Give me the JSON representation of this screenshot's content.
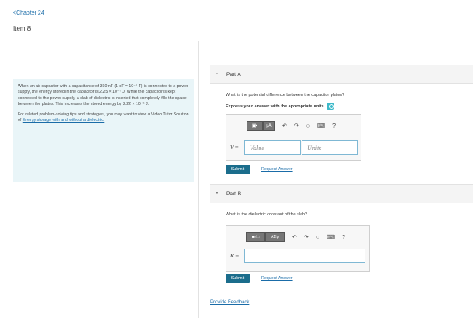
{
  "header": {
    "back_label": "<Chapter 24",
    "item_title": "Item 8"
  },
  "problem": {
    "paragraph1": "When an air capacitor with a capacitance of 360 nF (1 nF = 10⁻⁹ F) is connected to a power supply, the energy stored in the capacitor is 2.25 × 10⁻⁵ J. While the capacitor is kept connected to the power supply, a slab of dielectric is inserted that completely fills the space between the plates. This increases the stored energy by 2.22 × 10⁻⁵ J.",
    "paragraph2_prefix": "For related problem-solving tips and strategies, you may want to view a Video Tutor Solution of ",
    "paragraph2_link": "Energy storage with and without a dielectric."
  },
  "part_a": {
    "label": "Part A",
    "question": "What is the potential difference between the capacitor plates?",
    "instruction": "Express your answer with the appropriate units.",
    "variable": "V =",
    "value_placeholder": "Value",
    "units_placeholder": "Units",
    "toolbar": {
      "template_btn": "▣▪",
      "units_btn": "μA",
      "help": "?"
    },
    "submit": "Submit",
    "request": "Request Answer"
  },
  "part_b": {
    "label": "Part B",
    "question": "What is the dielectric constant of the slab?",
    "variable": "K =",
    "toolbar": {
      "template_btn": "■√□",
      "greek_btn": "ΑΣφ",
      "help": "?"
    },
    "submit": "Submit",
    "request": "Request Answer"
  },
  "footer": {
    "feedback": "Provide Feedback"
  },
  "icons": {
    "undo": "↶",
    "redo": "↷",
    "reset": "○",
    "keyboard": "⌨"
  },
  "colors": {
    "link": "#1a6ca8",
    "submit": "#1b6d8c",
    "problem_bg": "#e9f5f8",
    "info_badge": "#3cb9c9"
  }
}
